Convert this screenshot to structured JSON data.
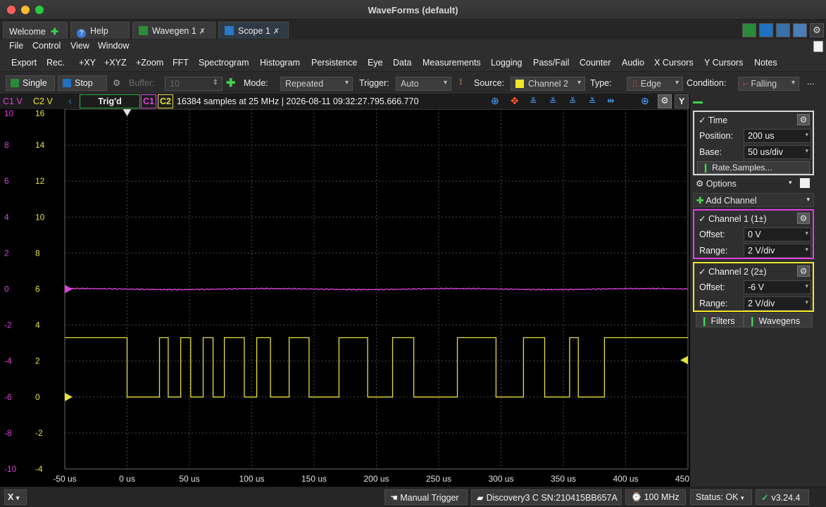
{
  "window": {
    "title": "WaveForms (default)"
  },
  "tabs": [
    {
      "label": "Welcome"
    },
    {
      "label": "Help"
    },
    {
      "label": "Wavegen 1"
    },
    {
      "label": "Scope 1"
    }
  ],
  "menu": [
    "File",
    "Control",
    "View",
    "Window"
  ],
  "toolbar1": [
    "Export",
    "Rec.",
    "+XY",
    "+XYZ",
    "+Zoom",
    "FFT",
    "Spectrogram",
    "Histogram",
    "Persistence",
    "Eye",
    "Data",
    "Measurements",
    "Logging",
    "Pass/Fail",
    "Counter",
    "Audio",
    "X Cursors",
    "Y Cursors",
    "Notes"
  ],
  "toolbar2": {
    "single": "Single",
    "stop": "Stop",
    "buffer_label": "Buffer:",
    "buffer_value": "10",
    "mode_label": "Mode:",
    "mode_value": "Repeated",
    "trigger_label": "Trigger:",
    "trigger_value": "Auto",
    "source_label": "Source:",
    "source_value": "Channel 2",
    "type_label": "Type:",
    "type_value": "Edge",
    "condition_label": "Condition:",
    "condition_value": "Falling",
    "more": "..."
  },
  "plot_header": {
    "c1_axis": "C1 V",
    "c2_axis": "C2 V",
    "status": "Trig'd",
    "c1": "C1",
    "c2": "C2",
    "info": "16384 samples at 25 MHz  | 2026-08-11 09:32:27.795.666.770",
    "y_button": "Y"
  },
  "chart_data": {
    "type": "line",
    "x_unit": "us",
    "xlim": [
      -50,
      450
    ],
    "x_ticks": [
      "-50 us",
      "0 us",
      "50 us",
      "100 us",
      "150 us",
      "200 us",
      "250 us",
      "300 us",
      "350 us",
      "400 us",
      "450 us"
    ],
    "c1_ticks": [
      "10",
      "8",
      "6",
      "4",
      "2",
      "0",
      "-2",
      "-4",
      "-6",
      "-8",
      "-10"
    ],
    "c2_ticks": [
      "16",
      "14",
      "12",
      "10",
      "8",
      "6",
      "4",
      "2",
      "0",
      "-2",
      "-4"
    ],
    "c1_ylim": [
      -10,
      10
    ],
    "c2_ylim": [
      -4,
      16
    ],
    "grid": true,
    "series": [
      {
        "name": "C1",
        "color": "#e040e0",
        "axis": "c1",
        "constant": 0
      },
      {
        "name": "C2",
        "color": "#e8e03a",
        "axis": "c2",
        "high": 3.3,
        "low": 0,
        "edges_x": [
          0,
          26,
          33,
          43,
          51,
          61,
          69,
          78,
          94,
          104,
          115,
          130,
          146,
          170,
          193,
          213,
          230,
          265,
          296,
          318,
          335,
          355,
          362,
          383
        ]
      }
    ]
  },
  "time_panel": {
    "title": "Time",
    "position_label": "Position:",
    "position_value": "200 us",
    "base_label": "Base:",
    "base_value": "50 us/div",
    "rate_button": "Rate,Samples..."
  },
  "options": {
    "label": "Options",
    "add_channel": "Add Channel"
  },
  "channel1": {
    "title": "Channel 1 (1±)",
    "offset_label": "Offset:",
    "offset_value": "0 V",
    "range_label": "Range:",
    "range_value": "2 V/div"
  },
  "channel2": {
    "title": "Channel 2 (2±)",
    "offset_label": "Offset:",
    "offset_value": "-6 V",
    "range_label": "Range:",
    "range_value": "2 V/div"
  },
  "filters_button": "Filters",
  "wavegens_button": "Wavegens",
  "statusbar": {
    "x_button": "X",
    "manual_trigger": "Manual Trigger",
    "device": "Discovery3 C SN:210415BB657A",
    "freq": "100 MHz",
    "status": "Status: OK",
    "version": "v3.24.4"
  }
}
